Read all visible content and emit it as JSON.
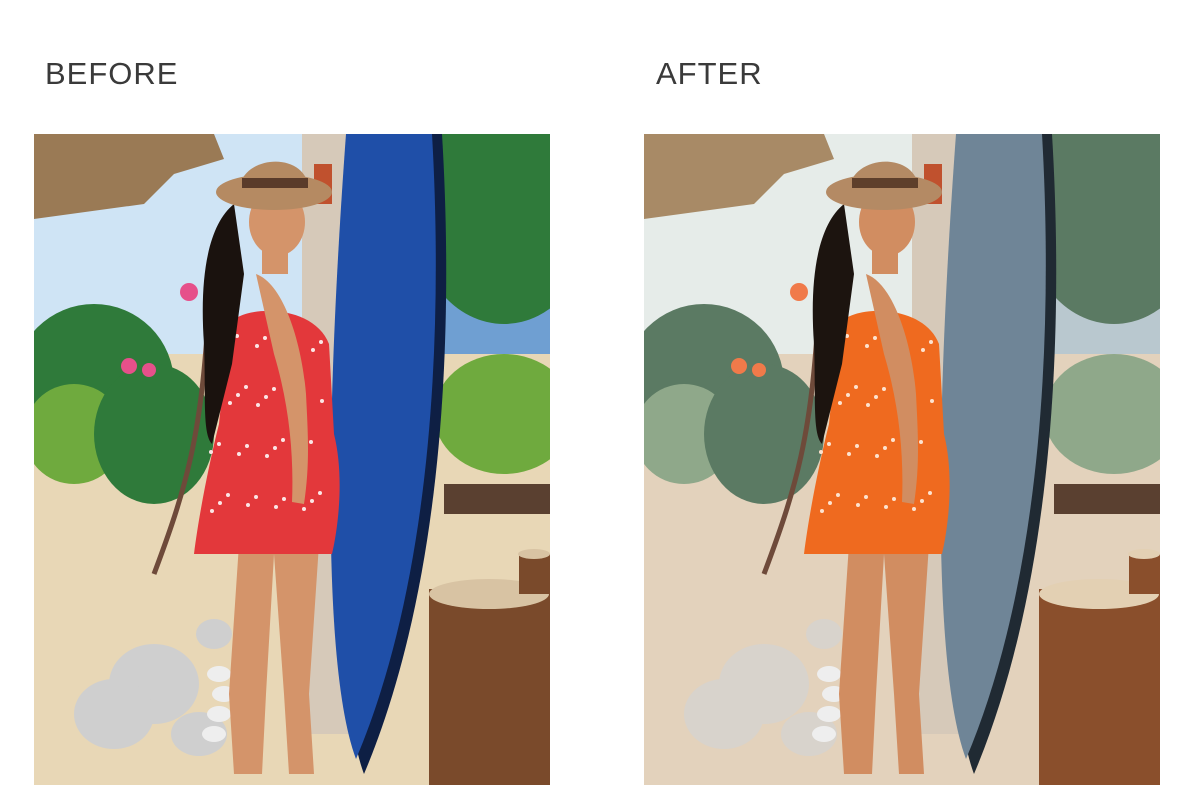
{
  "labels": {
    "before": "BEFORE",
    "after": "AFTER"
  },
  "panels": {
    "before": {
      "sky": "#cfe4f5",
      "sea": "#6f9fd2",
      "foliage": "#2f7a3a",
      "foliage_light": "#6faa3e",
      "sand": "#e8d7b6",
      "surfboard": "#1f4fa8",
      "surfboard_edge": "#0e1f44",
      "dress": "#e3383b",
      "dress_dots": "#fbe6e6",
      "skin": "#d4946a",
      "hair": "#1a120e",
      "hat": "#b58a62",
      "hat_band": "#5a3b2a",
      "stump": "#7a4a2b",
      "stump_top": "#d8c3a3",
      "rocks": "#cfcfcf",
      "flower": "#e6508a",
      "roof": "#9a7a55"
    },
    "after": {
      "sky": "#e6ece9",
      "sea": "#b9c8cf",
      "foliage": "#5b7a63",
      "foliage_light": "#8fa88a",
      "sand": "#e3d2bc",
      "surfboard": "#6f8597",
      "surfboard_edge": "#202a33",
      "dress": "#ef6a1f",
      "dress_dots": "#fde3cf",
      "skin": "#d18d61",
      "hair": "#1c140f",
      "hat": "#b48a64",
      "hat_band": "#5e3f2b",
      "stump": "#8a4f2c",
      "stump_top": "#e3d0b3",
      "rocks": "#d8d3cc",
      "flower": "#f07a4a",
      "roof": "#a88a66"
    }
  }
}
